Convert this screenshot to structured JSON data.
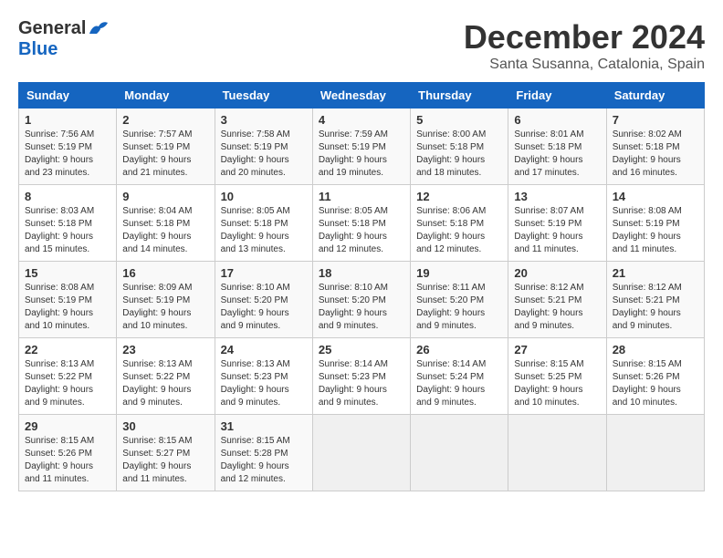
{
  "header": {
    "logo_general": "General",
    "logo_blue": "Blue",
    "title": "December 2024",
    "subtitle": "Santa Susanna, Catalonia, Spain"
  },
  "calendar": {
    "days_of_week": [
      "Sunday",
      "Monday",
      "Tuesday",
      "Wednesday",
      "Thursday",
      "Friday",
      "Saturday"
    ],
    "weeks": [
      [
        {
          "day": "1",
          "sunrise": "Sunrise: 7:56 AM",
          "sunset": "Sunset: 5:19 PM",
          "daylight": "Daylight: 9 hours and 23 minutes."
        },
        {
          "day": "2",
          "sunrise": "Sunrise: 7:57 AM",
          "sunset": "Sunset: 5:19 PM",
          "daylight": "Daylight: 9 hours and 21 minutes."
        },
        {
          "day": "3",
          "sunrise": "Sunrise: 7:58 AM",
          "sunset": "Sunset: 5:19 PM",
          "daylight": "Daylight: 9 hours and 20 minutes."
        },
        {
          "day": "4",
          "sunrise": "Sunrise: 7:59 AM",
          "sunset": "Sunset: 5:19 PM",
          "daylight": "Daylight: 9 hours and 19 minutes."
        },
        {
          "day": "5",
          "sunrise": "Sunrise: 8:00 AM",
          "sunset": "Sunset: 5:18 PM",
          "daylight": "Daylight: 9 hours and 18 minutes."
        },
        {
          "day": "6",
          "sunrise": "Sunrise: 8:01 AM",
          "sunset": "Sunset: 5:18 PM",
          "daylight": "Daylight: 9 hours and 17 minutes."
        },
        {
          "day": "7",
          "sunrise": "Sunrise: 8:02 AM",
          "sunset": "Sunset: 5:18 PM",
          "daylight": "Daylight: 9 hours and 16 minutes."
        }
      ],
      [
        {
          "day": "8",
          "sunrise": "Sunrise: 8:03 AM",
          "sunset": "Sunset: 5:18 PM",
          "daylight": "Daylight: 9 hours and 15 minutes."
        },
        {
          "day": "9",
          "sunrise": "Sunrise: 8:04 AM",
          "sunset": "Sunset: 5:18 PM",
          "daylight": "Daylight: 9 hours and 14 minutes."
        },
        {
          "day": "10",
          "sunrise": "Sunrise: 8:05 AM",
          "sunset": "Sunset: 5:18 PM",
          "daylight": "Daylight: 9 hours and 13 minutes."
        },
        {
          "day": "11",
          "sunrise": "Sunrise: 8:05 AM",
          "sunset": "Sunset: 5:18 PM",
          "daylight": "Daylight: 9 hours and 12 minutes."
        },
        {
          "day": "12",
          "sunrise": "Sunrise: 8:06 AM",
          "sunset": "Sunset: 5:18 PM",
          "daylight": "Daylight: 9 hours and 12 minutes."
        },
        {
          "day": "13",
          "sunrise": "Sunrise: 8:07 AM",
          "sunset": "Sunset: 5:19 PM",
          "daylight": "Daylight: 9 hours and 11 minutes."
        },
        {
          "day": "14",
          "sunrise": "Sunrise: 8:08 AM",
          "sunset": "Sunset: 5:19 PM",
          "daylight": "Daylight: 9 hours and 11 minutes."
        }
      ],
      [
        {
          "day": "15",
          "sunrise": "Sunrise: 8:08 AM",
          "sunset": "Sunset: 5:19 PM",
          "daylight": "Daylight: 9 hours and 10 minutes."
        },
        {
          "day": "16",
          "sunrise": "Sunrise: 8:09 AM",
          "sunset": "Sunset: 5:19 PM",
          "daylight": "Daylight: 9 hours and 10 minutes."
        },
        {
          "day": "17",
          "sunrise": "Sunrise: 8:10 AM",
          "sunset": "Sunset: 5:20 PM",
          "daylight": "Daylight: 9 hours and 9 minutes."
        },
        {
          "day": "18",
          "sunrise": "Sunrise: 8:10 AM",
          "sunset": "Sunset: 5:20 PM",
          "daylight": "Daylight: 9 hours and 9 minutes."
        },
        {
          "day": "19",
          "sunrise": "Sunrise: 8:11 AM",
          "sunset": "Sunset: 5:20 PM",
          "daylight": "Daylight: 9 hours and 9 minutes."
        },
        {
          "day": "20",
          "sunrise": "Sunrise: 8:12 AM",
          "sunset": "Sunset: 5:21 PM",
          "daylight": "Daylight: 9 hours and 9 minutes."
        },
        {
          "day": "21",
          "sunrise": "Sunrise: 8:12 AM",
          "sunset": "Sunset: 5:21 PM",
          "daylight": "Daylight: 9 hours and 9 minutes."
        }
      ],
      [
        {
          "day": "22",
          "sunrise": "Sunrise: 8:13 AM",
          "sunset": "Sunset: 5:22 PM",
          "daylight": "Daylight: 9 hours and 9 minutes."
        },
        {
          "day": "23",
          "sunrise": "Sunrise: 8:13 AM",
          "sunset": "Sunset: 5:22 PM",
          "daylight": "Daylight: 9 hours and 9 minutes."
        },
        {
          "day": "24",
          "sunrise": "Sunrise: 8:13 AM",
          "sunset": "Sunset: 5:23 PM",
          "daylight": "Daylight: 9 hours and 9 minutes."
        },
        {
          "day": "25",
          "sunrise": "Sunrise: 8:14 AM",
          "sunset": "Sunset: 5:23 PM",
          "daylight": "Daylight: 9 hours and 9 minutes."
        },
        {
          "day": "26",
          "sunrise": "Sunrise: 8:14 AM",
          "sunset": "Sunset: 5:24 PM",
          "daylight": "Daylight: 9 hours and 9 minutes."
        },
        {
          "day": "27",
          "sunrise": "Sunrise: 8:15 AM",
          "sunset": "Sunset: 5:25 PM",
          "daylight": "Daylight: 9 hours and 10 minutes."
        },
        {
          "day": "28",
          "sunrise": "Sunrise: 8:15 AM",
          "sunset": "Sunset: 5:26 PM",
          "daylight": "Daylight: 9 hours and 10 minutes."
        }
      ],
      [
        {
          "day": "29",
          "sunrise": "Sunrise: 8:15 AM",
          "sunset": "Sunset: 5:26 PM",
          "daylight": "Daylight: 9 hours and 11 minutes."
        },
        {
          "day": "30",
          "sunrise": "Sunrise: 8:15 AM",
          "sunset": "Sunset: 5:27 PM",
          "daylight": "Daylight: 9 hours and 11 minutes."
        },
        {
          "day": "31",
          "sunrise": "Sunrise: 8:15 AM",
          "sunset": "Sunset: 5:28 PM",
          "daylight": "Daylight: 9 hours and 12 minutes."
        },
        {
          "day": "",
          "sunrise": "",
          "sunset": "",
          "daylight": ""
        },
        {
          "day": "",
          "sunrise": "",
          "sunset": "",
          "daylight": ""
        },
        {
          "day": "",
          "sunrise": "",
          "sunset": "",
          "daylight": ""
        },
        {
          "day": "",
          "sunrise": "",
          "sunset": "",
          "daylight": ""
        }
      ]
    ]
  }
}
